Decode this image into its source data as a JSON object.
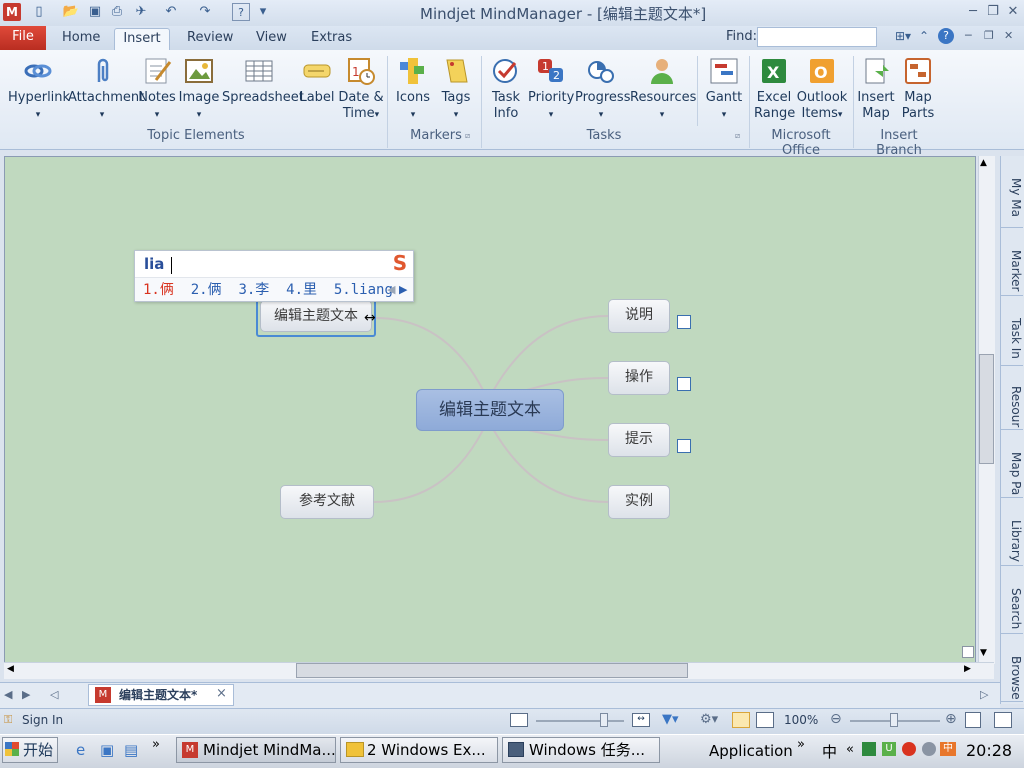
{
  "titlebar": {
    "app_icon": "M",
    "title": "Mindjet MindManager - [编辑主题文本*]",
    "icons": [
      "new-icon",
      "open-icon",
      "save-icon",
      "print-icon",
      "send-icon",
      "undo-icon",
      "redo-icon",
      "help-icon",
      "customize-icon"
    ]
  },
  "tabs": {
    "file": "File",
    "items": [
      "Home",
      "Insert",
      "Review",
      "View",
      "Extras"
    ],
    "active": "Insert",
    "find_label": "Find:"
  },
  "ribbon": {
    "topic_elements": {
      "label": "Topic Elements",
      "buttons": [
        {
          "label": "Hyperlink",
          "icon": "hyperlink-icon"
        },
        {
          "label": "Attachment",
          "icon": "paperclip-icon"
        },
        {
          "label": "Notes",
          "icon": "notes-icon"
        },
        {
          "label": "Image",
          "icon": "image-icon"
        },
        {
          "label": "Spreadsheet",
          "icon": "spreadsheet-icon"
        },
        {
          "label": "Label",
          "icon": "label-icon"
        },
        {
          "label": "Date &",
          "label2": "Time",
          "icon": "calendar-icon"
        }
      ]
    },
    "markers": {
      "label": "Markers",
      "buttons": [
        {
          "label": "Icons",
          "icon": "markers-icon"
        },
        {
          "label": "Tags",
          "icon": "tags-icon"
        }
      ]
    },
    "tasks": {
      "label": "Tasks",
      "buttons": [
        {
          "label": "Task",
          "label2": "Info",
          "icon": "task-info-icon"
        },
        {
          "label": "Priority",
          "icon": "priority-icon"
        },
        {
          "label": "Progress",
          "icon": "progress-icon"
        },
        {
          "label": "Resources",
          "icon": "resources-icon"
        },
        {
          "label": "Gantt",
          "icon": "gantt-icon"
        }
      ]
    },
    "microsoft_office": {
      "label": "Microsoft Office",
      "buttons": [
        {
          "label": "Excel",
          "label2": "Range",
          "icon": "excel-icon"
        },
        {
          "label": "Outlook",
          "label2": "Items",
          "icon": "outlook-icon"
        }
      ]
    },
    "insert_branch": {
      "label": "Insert Branch",
      "buttons": [
        {
          "label": "Insert",
          "label2": "Map",
          "icon": "insert-map-icon"
        },
        {
          "label": "Map",
          "label2": "Parts",
          "icon": "map-parts-icon"
        }
      ]
    }
  },
  "ime": {
    "input": "lia",
    "candidates": [
      "1.俩",
      "2.俩",
      "3.李",
      "4.里",
      "5.liang"
    ]
  },
  "mindmap": {
    "central": "编辑主题文本",
    "editing_topic": "编辑主题文本",
    "topics": [
      "说明",
      "操作",
      "提示",
      "实例",
      "参考文献"
    ]
  },
  "right_panel": {
    "tabs": [
      "My Ma",
      "Marker",
      "Task In",
      "Resour",
      "Map Pa",
      "Library",
      "Search",
      "Browse"
    ]
  },
  "doc_tab": {
    "label": "编辑主题文本*",
    "close": "×"
  },
  "status": {
    "sign_in": "Sign In",
    "zoom": "100%"
  },
  "taskbar": {
    "start": "开始",
    "buttons": [
      "Mindjet MindMa...",
      "2 Windows Ex...",
      "Windows 任务..."
    ],
    "app_label": "Application",
    "ime": "中",
    "clock": "20:28"
  },
  "colors": {
    "canvas_bg": "#c0d9bf",
    "central_topic": "#9db5de",
    "file_tab": "#c63a2f",
    "connector": "#c9c2c4"
  }
}
